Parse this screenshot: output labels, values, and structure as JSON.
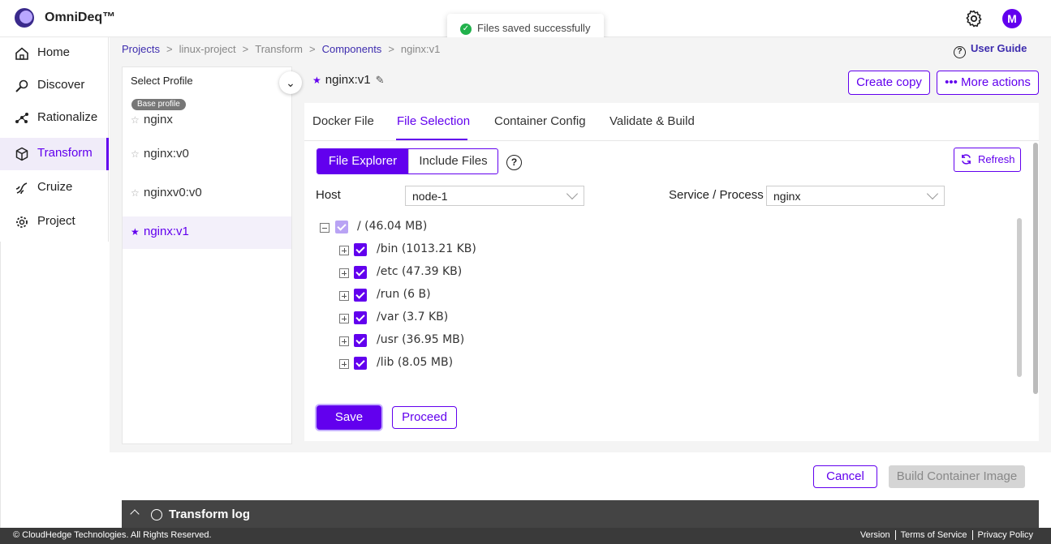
{
  "app": {
    "brand": "OmniDeq™",
    "avatar_initial": "M"
  },
  "toast": {
    "message": "Files saved successfully"
  },
  "sidebar": {
    "items": [
      {
        "label": "Home",
        "icon": "home-icon"
      },
      {
        "label": "Discover",
        "icon": "discover-icon"
      },
      {
        "label": "Rationalize",
        "icon": "rationalize-icon"
      },
      {
        "label": "Transform",
        "icon": "cube-icon",
        "active": true
      },
      {
        "label": "Cruize",
        "icon": "cruize-icon"
      },
      {
        "label": "Project",
        "icon": "gear-icon"
      }
    ]
  },
  "breadcrumb": {
    "items": [
      "Projects",
      "linux-project",
      "Transform",
      "Components",
      "nginx:v1"
    ]
  },
  "user_guide": "User Guide",
  "profiles": {
    "select_label": "Select Profile",
    "badge": "Base profile",
    "items": [
      "nginx",
      "nginx:v0",
      "nginxv0:v0",
      "nginx:v1"
    ],
    "active": "nginx:v1"
  },
  "component": {
    "title": "nginx:v1"
  },
  "actions": {
    "create_copy": "Create copy",
    "more_actions": "••• More actions"
  },
  "tabs": [
    "Docker File",
    "File Selection",
    "Container Config",
    "Validate & Build"
  ],
  "active_tab": "File Selection",
  "segments": {
    "explorer": "File Explorer",
    "include": "Include Files"
  },
  "refresh": "Refresh",
  "host": {
    "label": "Host",
    "value": "node-1"
  },
  "service": {
    "label": "Service / Process",
    "value": "nginx"
  },
  "tree": {
    "root": "/ (46.04 MB)",
    "children": [
      "/bin (1013.21 KB)",
      "/etc (47.39 KB)",
      "/run (6 B)",
      "/var (3.7 KB)",
      "/usr (36.95 MB)",
      "/lib (8.05 MB)"
    ]
  },
  "buttons": {
    "save": "Save",
    "proceed": "Proceed",
    "cancel": "Cancel",
    "build": "Build Container Image"
  },
  "log": {
    "label": "Transform log"
  },
  "footer": {
    "copyright": "© CloudHedge Technologies. All Rights Reserved.",
    "links": [
      "Version",
      "Terms of Service",
      "Privacy Policy"
    ]
  },
  "colors": {
    "accent": "#6200ee",
    "success": "#21b14b",
    "log_bar": "#444444"
  }
}
